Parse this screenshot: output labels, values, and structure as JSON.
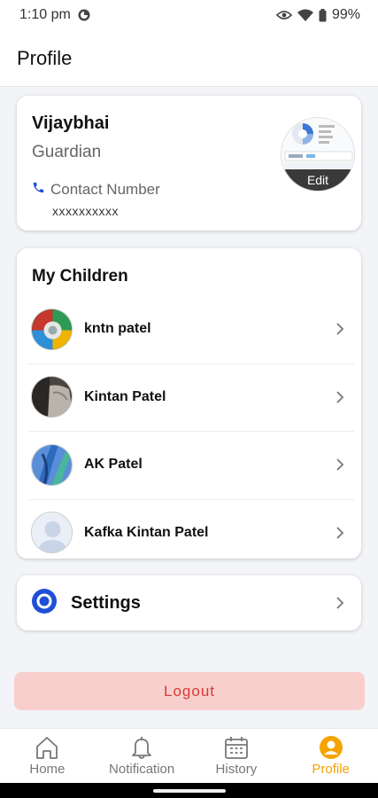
{
  "status_bar": {
    "time": "1:10 pm",
    "battery": "99%"
  },
  "header": {
    "title": "Profile"
  },
  "profile": {
    "name": "Vijaybhai",
    "role": "Guardian",
    "contact_label": "Contact Number",
    "contact_value": "xxxxxxxxxx",
    "edit_label": "Edit"
  },
  "children": {
    "title": "My Children",
    "items": [
      {
        "name": "kntn patel"
      },
      {
        "name": "Kintan Patel"
      },
      {
        "name": "AK Patel"
      },
      {
        "name": "Kafka Kintan Patel"
      }
    ]
  },
  "settings": {
    "label": "Settings"
  },
  "logout": {
    "label": "Logout"
  },
  "bottom_nav": {
    "items": [
      {
        "label": "Home",
        "icon": "home-icon"
      },
      {
        "label": "Notification",
        "icon": "bell-icon"
      },
      {
        "label": "History",
        "icon": "calendar-icon"
      },
      {
        "label": "Profile",
        "icon": "profile-icon"
      }
    ],
    "active_index": 3
  },
  "colors": {
    "accent": "#f5a300",
    "logout_text": "#d63a33",
    "logout_bg": "#f8cfcd",
    "link_blue": "#1f4fd6"
  }
}
